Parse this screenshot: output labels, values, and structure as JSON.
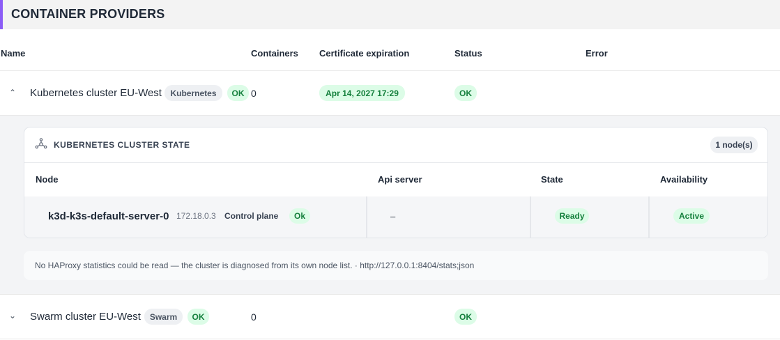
{
  "section": {
    "title": "CONTAINER PROVIDERS"
  },
  "columns": {
    "name": "Name",
    "containers": "Containers",
    "certificate": "Certificate expiration",
    "status": "Status",
    "error": "Error"
  },
  "providers": [
    {
      "name": "Kubernetes cluster EU-West",
      "type_badge": "Kubernetes",
      "health_badge": "OK",
      "containers": "0",
      "certificate_expiration": "Apr 14, 2027 17:29",
      "status": "OK",
      "expanded": true
    },
    {
      "name": "Swarm cluster EU-West",
      "type_badge": "Swarm",
      "health_badge": "OK",
      "containers": "0",
      "status": "OK",
      "expanded": false
    }
  ],
  "cluster_state": {
    "title": "KUBERNETES CLUSTER STATE",
    "node_count": "1 node(s)",
    "columns": {
      "node": "Node",
      "api_server": "Api server",
      "state": "State",
      "availability": "Availability"
    },
    "nodes": [
      {
        "name": "k3d-k3s-default-server-0",
        "ip": "172.18.0.3",
        "role": "Control plane",
        "health": "Ok",
        "api_server": "–",
        "state": "Ready",
        "availability": "Active"
      }
    ],
    "note": "No HAProxy statistics could be read — the cluster is diagnosed from its own node list. · http://127.0.0.1:8404/stats;json"
  },
  "colors": {
    "accent": "#8b5cf6",
    "ok_green": "#15803d",
    "ok_bg": "#dcfce7"
  }
}
